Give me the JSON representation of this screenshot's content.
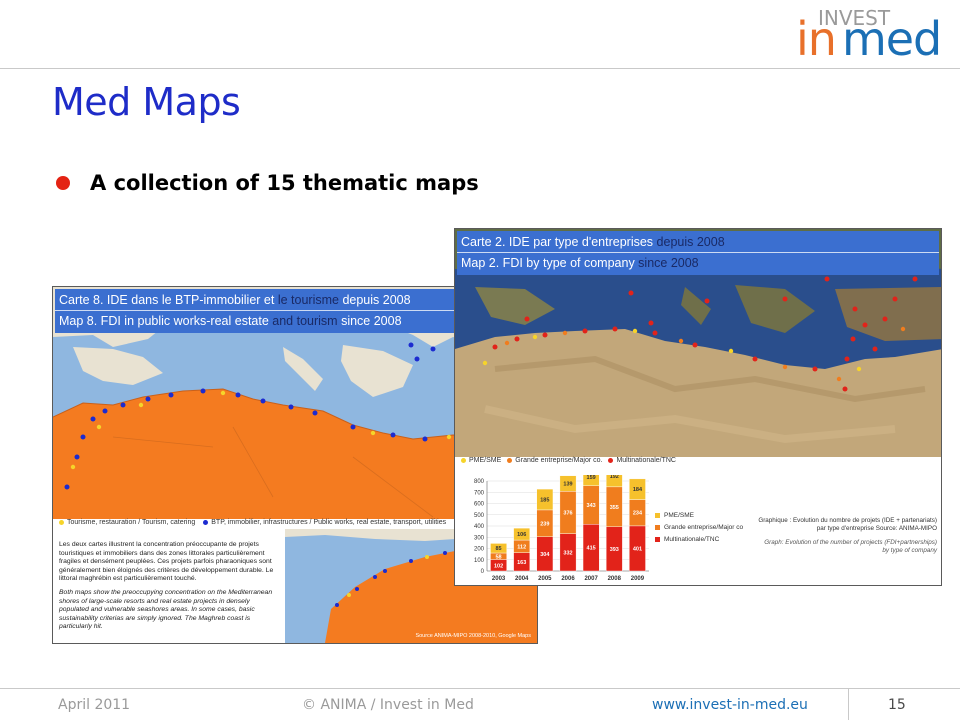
{
  "logo": {
    "word_invest": "INVEST",
    "word_in": "in",
    "word_med": "med"
  },
  "title": "Med Maps",
  "bullet": "A collection of 15 thematic maps",
  "map_left": {
    "header_fr_a": "Carte 8. IDE dans le BTP-immobilier et ",
    "header_fr_b": "le tourisme",
    "header_fr_c": " depuis 2008",
    "header_en_a": "Map 8. FDI in public works-real estate ",
    "header_en_b": "and tourism",
    "header_en_c": " since 2008",
    "legend_tourism": "Tourisme, restauration / Tourism, catering",
    "legend_btp": "BTP, immobilier, infrastructures / Public works, real estate, transport, utilities",
    "text_fr": "Les deux cartes illustrent la concentration préoccupante de projets touristiques et immobiliers dans des zones littorales particulièrement fragiles et densément peuplées. Ces projets parfois pharaoniques sont généralement bien éloignés des critères de développement durable. Le littoral maghrébin est particulièrement touché.",
    "text_en": "Both maps show the preoccupying concentration on the Mediterranean shores of large-scale resorts and real estate projects in densely populated and vulnerable seashores areas. In some cases, basic sustainability criterias are simply ignored. The Maghreb coast is particularly hit.",
    "credit": "Source ANIMA-MIPO 2008-2010, Google Maps"
  },
  "map_right": {
    "header_fr_a": "Carte 2. IDE par type d'entreprises ",
    "header_fr_b": "depuis 2008",
    "header_en_a": "Map 2. FDI by type of company ",
    "header_en_b": "since 2008",
    "legend_sme": "PME/SME",
    "legend_major": "Grande entreprise/Major co.",
    "legend_tnc": "Multinationale/TNC",
    "graph_caption_fr": "Graphique : Evolution du nombre de projets (IDE + partenariats) par type d'entreprise Source: ANIMA-MIPO",
    "graph_caption_en": "Graph: Evolution of the number of projects (FDI+partnerships) by type of company"
  },
  "chart_data": {
    "type": "bar",
    "stacked": true,
    "categories": [
      "2003",
      "2004",
      "2005",
      "2006",
      "2007",
      "2008",
      "2009"
    ],
    "series": [
      {
        "name": "Multinationale/TNC",
        "color": "#e2231a",
        "values": [
          102,
          163,
          304,
          332,
          415,
          393,
          401
        ]
      },
      {
        "name": "Grande entreprise/Major co",
        "color": "#f07d1e",
        "values": [
          58,
          112,
          239,
          376,
          343,
          355,
          234
        ]
      },
      {
        "name": "PME/SME",
        "color": "#f6c12c",
        "values": [
          85,
          106,
          185,
          139,
          159,
          192,
          184
        ]
      }
    ],
    "ylim": [
      0,
      800
    ],
    "yticks": [
      0,
      100,
      200,
      300,
      400,
      500,
      600,
      700,
      800
    ],
    "legend": [
      "PME/SME",
      "Grande entreprise/Major co",
      "Multinationale/TNC"
    ]
  },
  "footer": {
    "date": "April 2011",
    "copyright": "© ANIMA / Invest in Med",
    "url": "www.invest-in-med.eu",
    "page": "15"
  },
  "colors": {
    "title": "#1e2cc8",
    "bullet": "#e42313",
    "header_band": "#3b6fd0",
    "land_orange": "#f47b20",
    "sea_blue": "#8fb7e0"
  }
}
